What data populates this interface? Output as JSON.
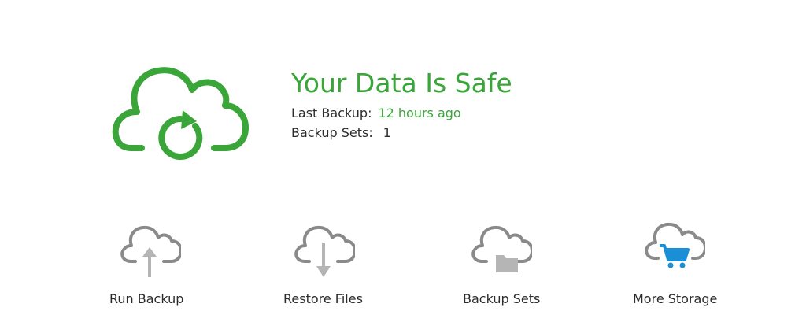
{
  "status": {
    "title": "Your Data Is Safe",
    "last_backup_label": "Last Backup:",
    "last_backup_value": "12 hours ago",
    "backup_sets_label": "Backup Sets:",
    "backup_sets_value": "1",
    "icon": "cloud-sync-icon"
  },
  "actions": [
    {
      "label": "Run Backup",
      "icon": "cloud-upload-icon"
    },
    {
      "label": "Restore Files",
      "icon": "cloud-download-icon"
    },
    {
      "label": "Backup Sets",
      "icon": "cloud-folder-icon"
    },
    {
      "label": "More Storage",
      "icon": "cloud-cart-icon"
    }
  ],
  "colors": {
    "accent_green": "#3aa63a",
    "text_dark": "#2b2b2b",
    "icon_gray": "#8a8a8a",
    "cart_blue": "#1a8fd6"
  }
}
